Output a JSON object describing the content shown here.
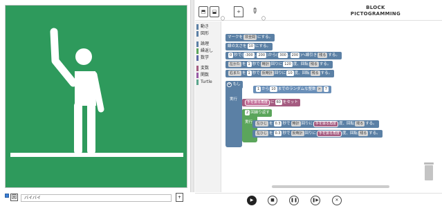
{
  "window": {
    "title_line1": "BLOCK",
    "title_line2": "PICTOGRAMMING"
  },
  "toolbar": {
    "open_icon": "open-file-icon",
    "save_icon": "save-icon",
    "new_icon": "new-file-icon",
    "pencil_icon": "pencil-icon",
    "open_sublabel": "〇",
    "pencil_sublabel": "〇"
  },
  "categories": [
    {
      "label": "動き",
      "color": "#5b80a5"
    },
    {
      "label": "図形",
      "color": "#5b80a5"
    },
    {
      "label": "論理",
      "color": "#5b80a5"
    },
    {
      "label": "繰返し",
      "color": "#5ba55b"
    },
    {
      "label": "数学",
      "color": "#5b67a5"
    },
    {
      "label": "変数",
      "color": "#a55b80"
    },
    {
      "label": "関数",
      "color": "#995ba5"
    },
    {
      "label": "Turtle",
      "color": "#5ba58c"
    }
  ],
  "blocks": {
    "b1": {
      "pre": "マークを",
      "dd": "非全間",
      "post": "にする。"
    },
    "b2": {
      "pre": "線の太さを",
      "val": "10",
      "post": "にする。"
    },
    "b3": {
      "v1": "0",
      "t1": "秒で(",
      "v2": "-300",
      "v3": "200",
      "t2": ")から(",
      "v4": "300",
      "v5": "200",
      "t3": ")へ線引き",
      "dd": "残る",
      "post": "する。"
    },
    "b4": {
      "dd1": "左かた",
      "t1": "を",
      "v1": "1",
      "t2": "秒で",
      "dd2": "時計",
      "t3": "回りに",
      "v2": "120",
      "t4": "度、回転",
      "dd3": "残る",
      "post": "する。"
    },
    "b5": {
      "dd1": "右また",
      "t1": "を",
      "v1": "1",
      "t2": "秒で",
      "dd2": "反時計",
      "t3": "回りに",
      "v2": "10",
      "t4": "度、回転",
      "dd3": "残る",
      "post": "する。"
    },
    "if_label": "もし",
    "b6": {
      "v1": "1",
      "t1": "から",
      "v2": "10",
      "t2": "までのランダムな整数",
      "op": ">",
      "v3": "7"
    },
    "do_label": "実行",
    "b7": {
      "var": "手を振る角度",
      "t1": "に",
      "v1": "60",
      "post": "をセット"
    },
    "b8": {
      "v1": "2",
      "post": "回繰り返す"
    },
    "loop_do": "実行",
    "b9": {
      "dd1": "左ひじ",
      "t1": "を",
      "v1": "0.3",
      "t2": "秒で",
      "dd2": "時計",
      "t3": "回りに",
      "var": "手を振る角度",
      "t4": "度、回転",
      "dd3": "残る",
      "post": "する。"
    },
    "b10": {
      "dd1": "左ひじ",
      "t1": "を",
      "v1": "0.3",
      "t2": "秒で",
      "dd2": "反時計",
      "t3": "回りに",
      "var": "手を振る角度",
      "t4": "度、回転",
      "dd3": "残る",
      "post": "する。"
    }
  },
  "bottom": {
    "text_value": "バイバイ"
  },
  "controls": [
    {
      "name": "play-button",
      "glyph": "▶"
    },
    {
      "name": "stop-button",
      "glyph": "■"
    },
    {
      "name": "pause-button",
      "glyph": "❚❚"
    },
    {
      "name": "step-button",
      "glyph": "❚▶"
    },
    {
      "name": "clear-button",
      "glyph": "✕"
    }
  ],
  "colors": {
    "canvas_bg": "#2e9a5c",
    "block_blue": "#5b80a5",
    "block_green": "#5ba55b",
    "block_pink": "#a55b80"
  }
}
